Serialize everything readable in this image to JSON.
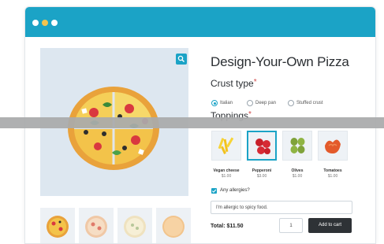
{
  "window": {
    "colors": {
      "titlebar": "#1ba3c6",
      "accent": "#1ba3c6",
      "dot_yellow": "#f4c44e"
    }
  },
  "product": {
    "title": "Design-Your-Own Pizza",
    "zoom_icon": "magnifier-icon"
  },
  "crust": {
    "label": "Crust type",
    "required_mark": "*",
    "options": [
      {
        "label": "Italian",
        "selected": true
      },
      {
        "label": "Deep pan",
        "selected": false
      },
      {
        "label": "Stuffed crust",
        "selected": false
      }
    ]
  },
  "toppings": {
    "label": "Toppings",
    "required_mark": "*",
    "items": [
      {
        "name": "Vegan cheese",
        "price": "$1.00",
        "selected": false,
        "icon": "cheese-icon"
      },
      {
        "name": "Pepperoni",
        "price": "$3.00",
        "selected": true,
        "icon": "pepperoni-icon"
      },
      {
        "name": "Olives",
        "price": "$1.00",
        "selected": false,
        "icon": "olives-icon"
      },
      {
        "name": "Tomatoes",
        "price": "$1.00",
        "selected": false,
        "icon": "tomatoes-icon"
      }
    ]
  },
  "allergies": {
    "checkbox_label": "Any allergies?",
    "checked": true,
    "field_value": "I'm allergic to spicy food."
  },
  "purchase": {
    "total": "Total: $11.50",
    "quantity": "1",
    "add_to_cart": "Add to cart"
  }
}
